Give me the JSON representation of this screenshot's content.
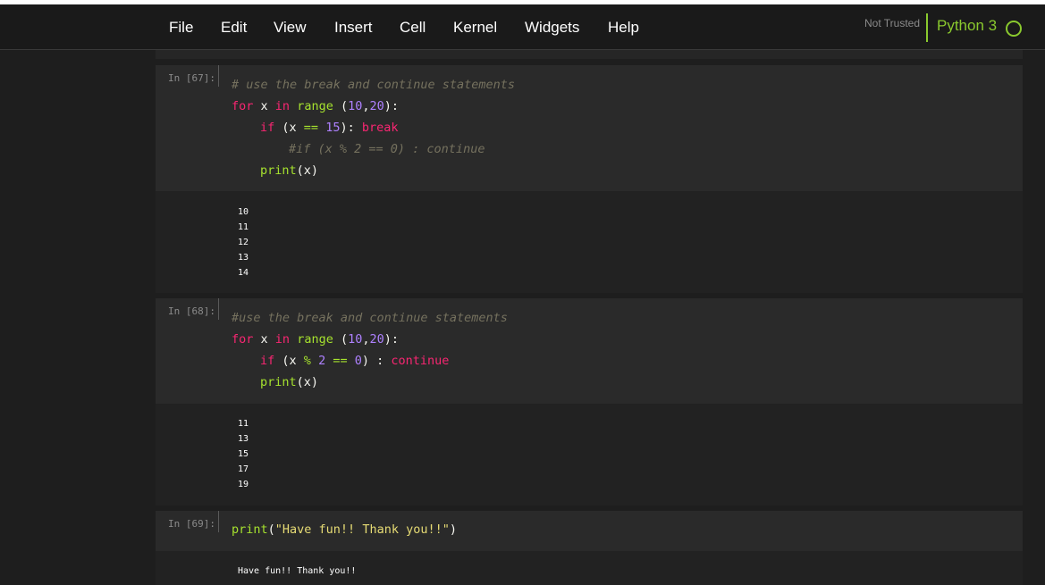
{
  "menu": {
    "items": [
      "File",
      "Edit",
      "View",
      "Insert",
      "Cell",
      "Kernel",
      "Widgets",
      "Help"
    ]
  },
  "status": {
    "trust": "Not Trusted",
    "kernel": "Python 3"
  },
  "colors": {
    "background": "#1e1e1e",
    "kernel_green": "#8ac92e",
    "keyword": "#f92672",
    "builtin": "#a6e22e",
    "number": "#ae81ff",
    "comment": "#75715e",
    "string": "#e6db74"
  },
  "icons": {
    "kernel_status": "circle-outline-icon"
  },
  "cells": [
    {
      "prompt": "In [67]:",
      "code": {
        "l1": "# use the break and continue statements",
        "l2_kw": "for",
        "l2_var": " x ",
        "l2_in": "in",
        "l2_fn": "range",
        "l2_o": " (",
        "l2_a": "10",
        "l2_c": ",",
        "l2_b": "20",
        "l2_e": "):",
        "l3_kw": "if",
        "l3_o": " (x ",
        "l3_op": "==",
        "l3_n": "15",
        "l3_c": "): ",
        "l3_br": "break",
        "l4": "#if (x % 2 == 0) : continue",
        "l5_fn": "print",
        "l5_a": "(x)"
      },
      "output": [
        "10",
        "11",
        "12",
        "13",
        "14"
      ]
    },
    {
      "prompt": "In [68]:",
      "code": {
        "l1": "#use the break and continue statements",
        "l2_kw": "for",
        "l2_var": " x ",
        "l2_in": "in",
        "l2_fn": "range",
        "l2_o": " (",
        "l2_a": "10",
        "l2_c": ",",
        "l2_b": "20",
        "l2_e": "):",
        "l3_kw": "if",
        "l3_o": " (x ",
        "l3_op": "%",
        "l3_n": "2",
        "l3_sp": " ",
        "l3_op2": "==",
        "l3_n2": "0",
        "l3_c": ") : ",
        "l3_ct": "continue",
        "l4_fn": "print",
        "l4_a": "(x)"
      },
      "output": [
        "11",
        "13",
        "15",
        "17",
        "19"
      ]
    },
    {
      "prompt": "In [69]:",
      "code": {
        "l1_fn": "print",
        "l1_o": "(",
        "l1_s": "\"Have fun!! Thank you!!\"",
        "l1_c": ")"
      },
      "output": [
        "Have fun!! Thank you!!"
      ]
    }
  ]
}
